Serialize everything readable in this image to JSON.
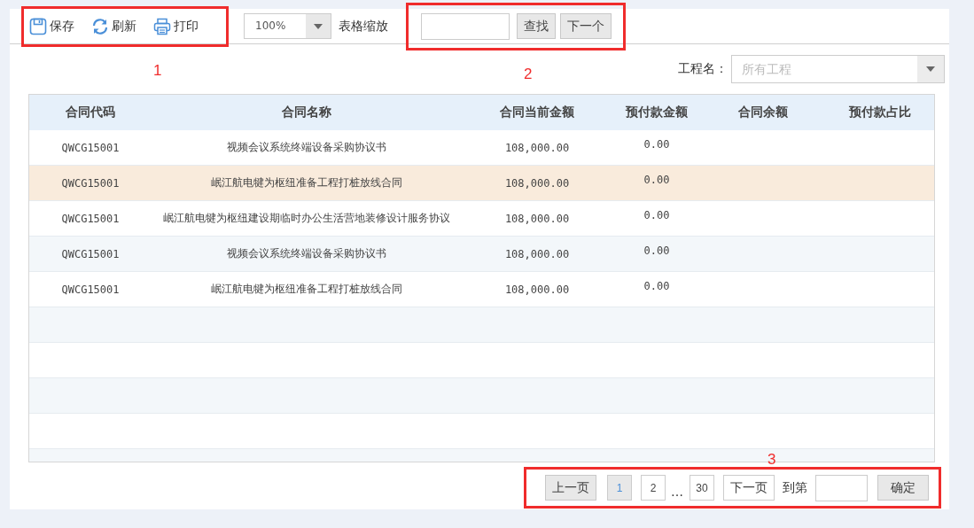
{
  "toolbar": {
    "annotation": "1",
    "actions": [
      {
        "kind": "save",
        "label": "保存"
      },
      {
        "kind": "refresh",
        "label": "刷新"
      },
      {
        "kind": "print",
        "label": "打印"
      }
    ],
    "zoom": {
      "value": "100%",
      "label": "表格缩放"
    }
  },
  "search": {
    "annotation": "2",
    "buttons": [
      "查找",
      "下一个"
    ]
  },
  "filter": {
    "label": "工程名：",
    "placeholder": "所有工程"
  },
  "table": {
    "columns": [
      "合同代码",
      "合同名称",
      "合同当前金额",
      "预付款金额",
      "合同余额",
      "预付款占比"
    ],
    "rows": [
      {
        "selected": false,
        "cells": [
          "QWCG15001",
          "视频会议系统终端设备采购协议书",
          "108,000.00",
          "0.00"
        ]
      },
      {
        "selected": true,
        "cells": [
          "QWCG15001",
          "岷江航电犍为枢纽准备工程打桩放线合同",
          "108,000.00",
          "0.00"
        ]
      },
      {
        "selected": false,
        "cells": [
          "QWCG15001",
          "岷江航电犍为枢纽建设期临时办公生活营地装修设计服务协议",
          "108,000.00",
          "0.00"
        ]
      },
      {
        "selected": false,
        "cells": [
          "QWCG15001",
          "视频会议系统终端设备采购协议书",
          "108,000.00",
          "0.00"
        ]
      },
      {
        "selected": false,
        "cells": [
          "QWCG15001",
          "岷江航电犍为枢纽准备工程打桩放线合同",
          "108,000.00",
          "0.00"
        ]
      }
    ]
  },
  "pagination": {
    "annotation": "3",
    "prev": "上一页",
    "pages": [
      {
        "label": "1",
        "selected": true
      },
      {
        "label": "2",
        "selected": false
      },
      {
        "label": "…",
        "kind": "gap"
      },
      {
        "label": "30",
        "selected": false
      }
    ],
    "next": "下一页",
    "goto_label": "到第",
    "confirm": "确定"
  }
}
